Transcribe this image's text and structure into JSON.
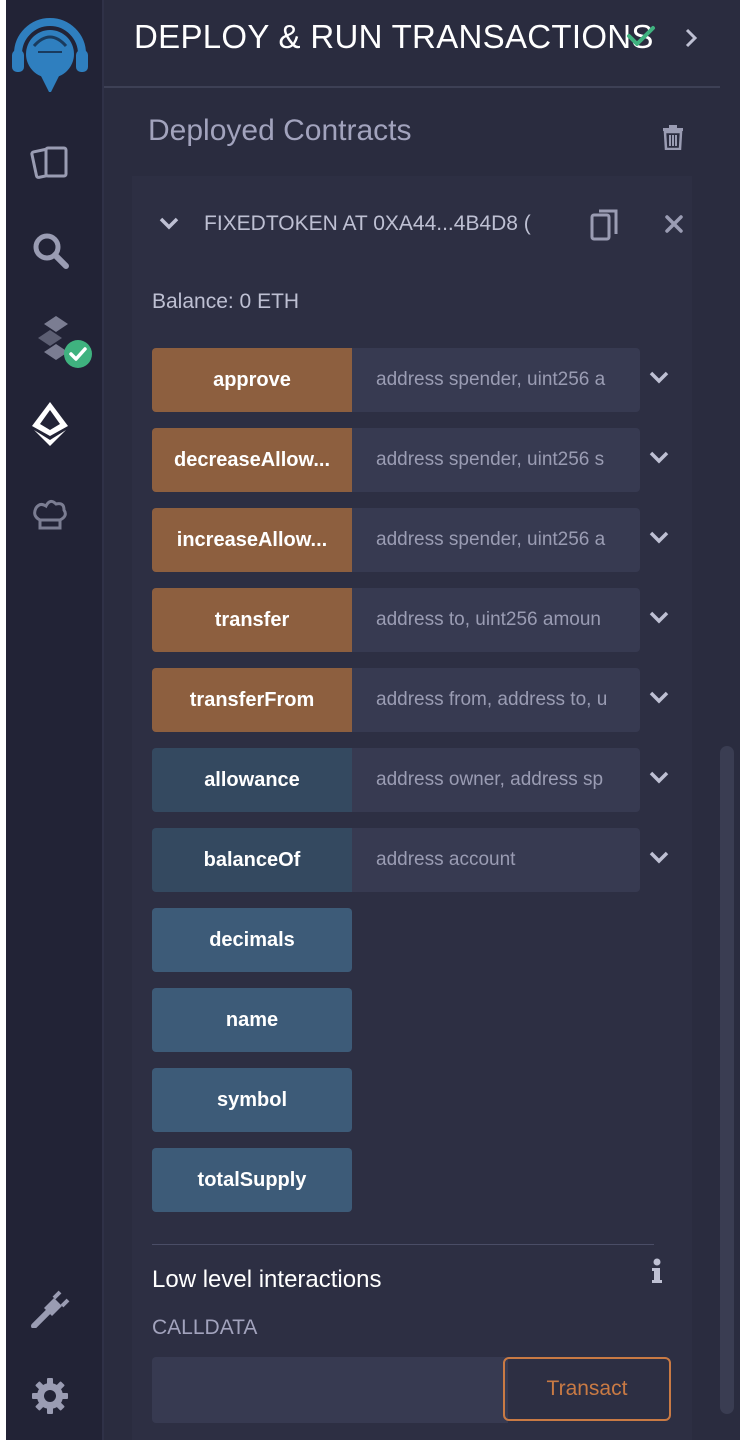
{
  "panel": {
    "title": "DEPLOY & RUN TRANSACTIONS",
    "subtitle": "Deployed Contracts"
  },
  "sidebar": {
    "icons": [
      "remix-logo-icon",
      "file-explorer-icon",
      "search-icon",
      "solidity-compiler-icon",
      "deploy-run-icon",
      "chef-hat-icon",
      "plugin-manager-icon",
      "settings-icon"
    ]
  },
  "contract": {
    "name": "FIXEDTOKEN AT 0XA44...4B4D8 (",
    "balance": "Balance: 0 ETH",
    "functions": [
      {
        "label": "approve",
        "placeholder": "address spender, uint256 a",
        "kind": "write"
      },
      {
        "label": "decreaseAllow...",
        "placeholder": "address spender, uint256 s",
        "kind": "write"
      },
      {
        "label": "increaseAllow...",
        "placeholder": "address spender, uint256 a",
        "kind": "write"
      },
      {
        "label": "transfer",
        "placeholder": "address to, uint256 amoun",
        "kind": "write"
      },
      {
        "label": "transferFrom",
        "placeholder": "address from, address to, u",
        "kind": "write"
      },
      {
        "label": "allowance",
        "placeholder": "address owner, address sp",
        "kind": "view"
      },
      {
        "label": "balanceOf",
        "placeholder": "address account",
        "kind": "view"
      },
      {
        "label": "decimals",
        "kind": "pure"
      },
      {
        "label": "name",
        "kind": "pure"
      },
      {
        "label": "symbol",
        "kind": "pure"
      },
      {
        "label": "totalSupply",
        "kind": "pure"
      }
    ]
  },
  "low_level": {
    "title": "Low level interactions",
    "calldata_label": "CALLDATA",
    "transact_label": "Transact"
  },
  "colors": {
    "write": "#8d5f3f",
    "view": "#344960",
    "pure": "#3d5b78",
    "accent_check": "#3fb27f",
    "transact": "#c97a44"
  }
}
